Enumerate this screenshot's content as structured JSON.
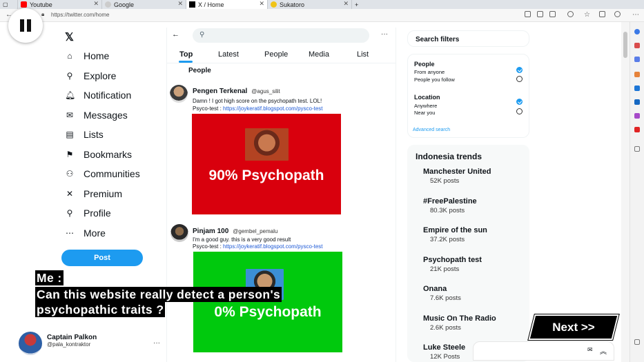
{
  "browser": {
    "tabs": [
      {
        "title": "Youtube",
        "fav_color": "#ff0000",
        "active": false
      },
      {
        "title": "Google",
        "fav_color": "#cccccc",
        "active": false
      },
      {
        "title": "X / Home",
        "fav_color": "#000000",
        "active": true
      },
      {
        "title": "Sukatoro",
        "fav_color": "#f0c419",
        "active": false
      }
    ],
    "new_tab": "+",
    "url": "https://twitter.com/home"
  },
  "sidebar": {
    "logo": "𝕏",
    "items": [
      {
        "label": "Home",
        "icon": "⌂",
        "icon_name": "home-icon"
      },
      {
        "label": "Explore",
        "icon": "⚲",
        "icon_name": "search-icon"
      },
      {
        "label": "Notification",
        "icon": "🔔︎",
        "icon_name": "bell-icon"
      },
      {
        "label": "Messages",
        "icon": "✉",
        "icon_name": "envelope-icon"
      },
      {
        "label": "Lists",
        "icon": "▤",
        "icon_name": "list-icon"
      },
      {
        "label": "Bookmarks",
        "icon": "⚑",
        "icon_name": "bookmark-icon"
      },
      {
        "label": "Communities",
        "icon": "⚇",
        "icon_name": "communities-icon"
      },
      {
        "label": "Premium",
        "icon": "✕",
        "icon_name": "x-premium-icon"
      },
      {
        "label": "Profile",
        "icon": "⚲",
        "icon_name": "profile-icon"
      },
      {
        "label": "More",
        "icon": "⋯",
        "icon_name": "more-icon"
      }
    ],
    "post_label": "Post",
    "user": {
      "name": "Captain Palkon",
      "handle": "@pala_kontraktor",
      "more": "···"
    }
  },
  "search": {
    "back": "←",
    "more": "···",
    "tabs": [
      "Top",
      "Latest",
      "People",
      "Media",
      "List"
    ],
    "section_label": "People"
  },
  "tweets": [
    {
      "name": "Pengen Terkenal",
      "handle": "@agus_silit",
      "text": "Damn ! I got high score on the psychopath test. LOL!",
      "link_prefix": "Psyco-test : ",
      "link": "https://joykeratif.blogspot.com/pysco-test",
      "card_caption": "90% Psychopath",
      "card_color": "#d9000d"
    },
    {
      "name": "Pinjam 100",
      "handle": "@gembel_pemalu",
      "text": "I'm a good guy. this is a very good result",
      "link_prefix": "Psyco-test : ",
      "link": "https://joykeratif.blogspot.com/pysco-test",
      "card_caption": "0% Psychopath",
      "card_color": "#00c90d"
    }
  ],
  "filters": {
    "title": "Search filters",
    "people_title": "People",
    "people_options": [
      "From anyone",
      "People you follow"
    ],
    "location_title": "Location",
    "location_options": [
      "Anywhere",
      "Near you"
    ],
    "advanced": "Advanced search"
  },
  "trends": {
    "title": "Indonesia trends",
    "items": [
      {
        "name": "Manchester United",
        "count": "52K posts"
      },
      {
        "name": "#FreePalestine",
        "count": "80.3K posts"
      },
      {
        "name": "Empire of the sun",
        "count": "37.2K posts"
      },
      {
        "name": "Psychopath test",
        "count": "21K posts"
      },
      {
        "name": "Onana",
        "count": "7.6K posts"
      },
      {
        "name": "Music On The Radio",
        "count": "2.6K posts"
      },
      {
        "name": "Luke Steele",
        "count": "12K Posts"
      }
    ]
  },
  "overlay": {
    "subtitle_lines": [
      "Me :",
      "Can this website really detect a person's",
      "psychopathic traits ?"
    ],
    "next_label": "Next >>"
  },
  "colors": {
    "accent": "#1d9bf0",
    "link": "#1d59d6"
  }
}
